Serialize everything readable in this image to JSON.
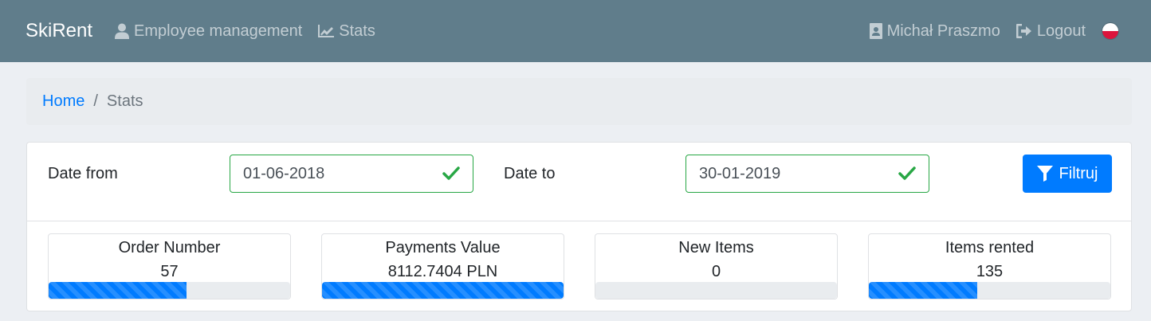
{
  "navbar": {
    "brand": "SkiRent",
    "links": [
      {
        "label": "Employee management",
        "icon": "user-icon"
      },
      {
        "label": "Stats",
        "icon": "chart-line-icon"
      }
    ],
    "user": {
      "label": "Michał Praszmo",
      "icon": "id-badge-icon"
    },
    "logout": {
      "label": "Logout",
      "icon": "sign-out-icon"
    },
    "language_flag": "poland-flag-icon"
  },
  "breadcrumb": {
    "home": "Home",
    "separator": "/",
    "current": "Stats"
  },
  "filter": {
    "date_from_label": "Date from",
    "date_from_value": "01-06-2018",
    "date_to_label": "Date to",
    "date_to_value": "30-01-2019",
    "button_label": "Filtruj"
  },
  "stats": [
    {
      "title": "Order Number",
      "value": "57",
      "progress": 0.57
    },
    {
      "title": "Payments Value",
      "value": "8112.7404 PLN",
      "progress": 1.0
    },
    {
      "title": "New Items",
      "value": "0",
      "progress": 0.0
    },
    {
      "title": "Items rented",
      "value": "135",
      "progress": 0.45
    }
  ],
  "colors": {
    "navbar": "#607d8b",
    "primary": "#007bff",
    "valid": "#28a745",
    "background": "#eceff3"
  }
}
